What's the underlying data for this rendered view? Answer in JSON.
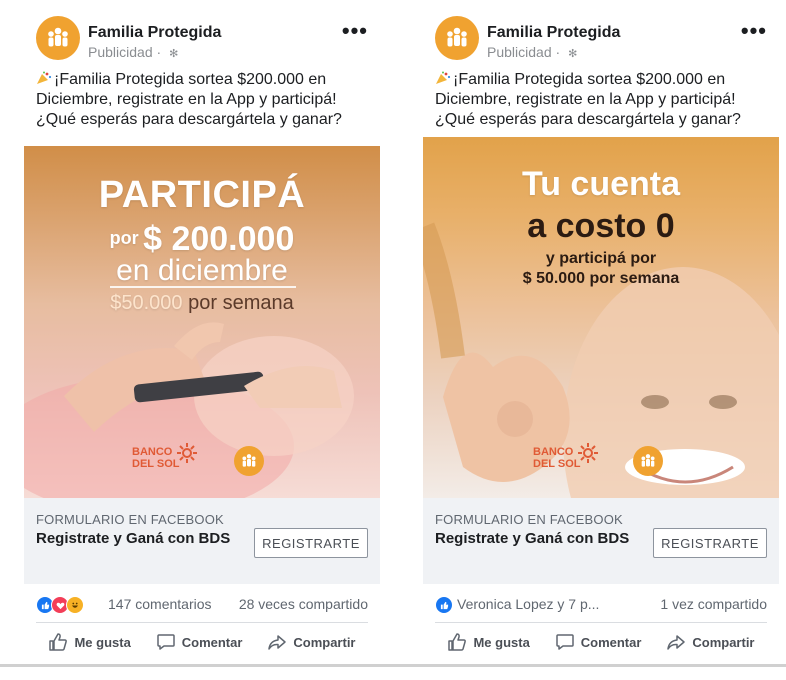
{
  "posts": [
    {
      "page_name": "Familia Protegida",
      "sponsored": "Publicidad",
      "more": "•••",
      "text": "¡Familia Protegida sortea $200.000 en Diciembre, registrate en la App y participá! ¿Qué esperás para descargártela y ganar?",
      "creative": {
        "headline": "PARTICIPÁ",
        "por": "por",
        "amount": "$ 200.000",
        "month": "en diciembre",
        "weekly_amount": "$50.000",
        "weekly_rest": "por semana",
        "bank_logo_line1": "BANCO",
        "bank_logo_line2": "DEL SOL"
      },
      "cta": {
        "kicker": "FORMULARIO EN FACEBOOK",
        "headline": "Registrate y Ganá con BDS",
        "button": "REGISTRARTE"
      },
      "stats": {
        "left": "147 comentarios",
        "right": "28 veces compartido"
      },
      "actions": {
        "like": "Me gusta",
        "comment": "Comentar",
        "share": "Compartir"
      }
    },
    {
      "page_name": "Familia Protegida",
      "sponsored": "Publicidad",
      "more": "•••",
      "text": "¡Familia Protegida sortea $200.000 en Diciembre, registrate en la App y participá! ¿Qué esperás para descargártela y ganar?",
      "creative": {
        "line1": "Tu cuenta",
        "line2": "a costo 0",
        "line3": "y participá por",
        "line4": "$ 50.000 por semana",
        "bank_logo_line1": "BANCO",
        "bank_logo_line2": "DEL SOL"
      },
      "cta": {
        "kicker": "FORMULARIO EN FACEBOOK",
        "headline": "Registrate y Ganá con BDS",
        "button": "REGISTRARTE"
      },
      "stats": {
        "left": "Veronica Lopez y 7 p...",
        "right": "1 vez compartido"
      },
      "actions": {
        "like": "Me gusta",
        "comment": "Comentar",
        "share": "Compartir"
      }
    }
  ],
  "colors": {
    "brand_orange": "#f0a230",
    "fb_blue": "#1877f2",
    "cta_bg": "#f0f2f5",
    "bank_red": "#e05a35"
  },
  "icons": [
    "globe-icon",
    "party-popper-icon",
    "more-icon",
    "like-reaction-icon",
    "love-reaction-icon",
    "haha-reaction-icon",
    "thumbs-up-icon",
    "comment-icon",
    "share-icon",
    "family-logo-icon",
    "sun-logo-icon"
  ]
}
